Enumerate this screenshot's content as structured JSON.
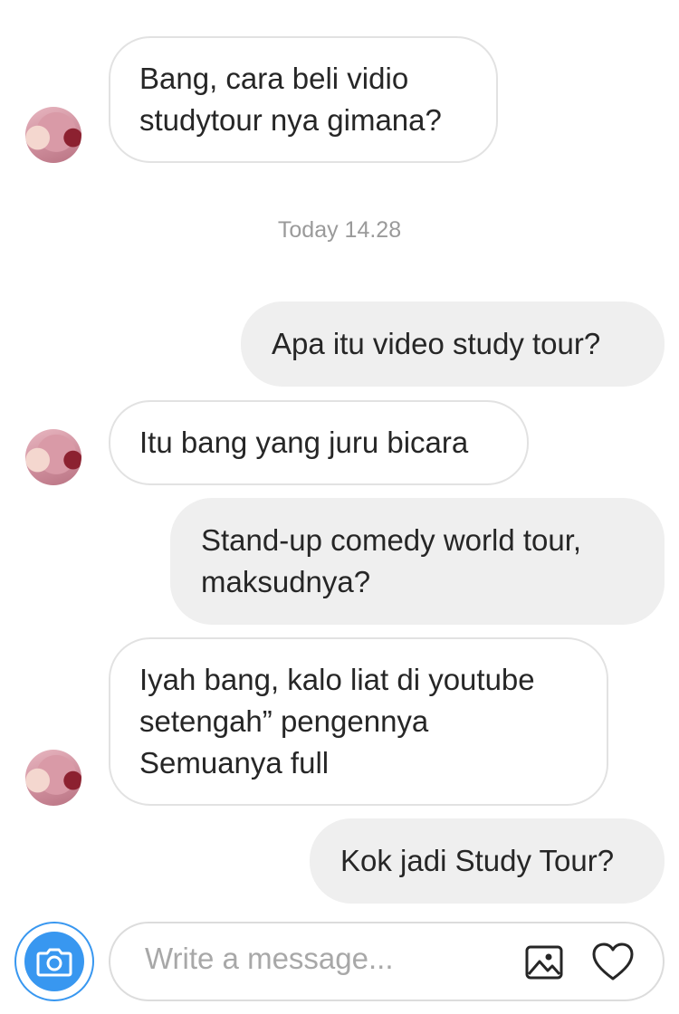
{
  "messages": [
    {
      "from": "them",
      "text": "Bang, cara beli vidio\nstudytour nya gimana?"
    },
    {
      "from": "me",
      "text": "Apa itu video study tour?"
    },
    {
      "from": "them",
      "text": "Itu bang yang juru bicara"
    },
    {
      "from": "me",
      "text": "Stand-up comedy world tour,\nmaksudnya?"
    },
    {
      "from": "them",
      "text": "Iyah bang, kalo liat di youtube\nsetengah” pengennya\nSemuanya full"
    },
    {
      "from": "me",
      "text": "Kok jadi Study Tour?"
    }
  ],
  "timestamp": "Today 14.28",
  "composer": {
    "placeholder": "Write a message...",
    "icons": [
      "camera-icon",
      "gallery-icon",
      "heart-icon"
    ]
  },
  "colors": {
    "accent": "#3897f0",
    "incoming_bubble": "#ffffff",
    "outgoing_bubble": "#efefef",
    "timestamp_text": "#9a9a9a"
  }
}
